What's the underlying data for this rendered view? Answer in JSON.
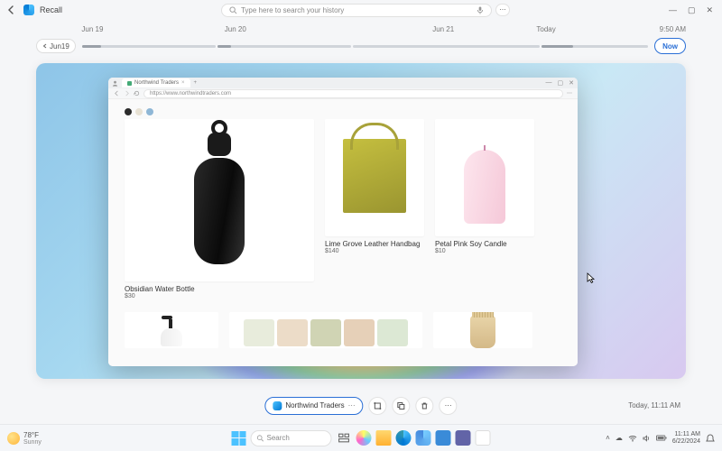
{
  "app": {
    "name": "Recall"
  },
  "search": {
    "placeholder": "Type here to search your history"
  },
  "window_controls": {
    "minimize": "—",
    "maximize": "▢",
    "close": "✕"
  },
  "timeline": {
    "prev_button": "Jun19",
    "now_button": "Now",
    "current_time": "9:50 AM",
    "marks": [
      {
        "label": "Jun 19",
        "pos": 0
      },
      {
        "label": "Jun 20",
        "pos": 25
      },
      {
        "label": "Jun 21",
        "pos": 57
      },
      {
        "label": "Today",
        "pos": 82
      }
    ]
  },
  "snapshot": {
    "browser": {
      "tab_title": "Northwind Traders",
      "url": "https://www.northwindtraders.com",
      "swatches": [
        "#2b2b2b",
        "#e8e2d4",
        "#8fb7d6"
      ],
      "products": [
        {
          "name": "Obsidian  Water Bottle",
          "price": "$30"
        },
        {
          "name": "Lime Grove Leather Handbag",
          "price": "$140"
        },
        {
          "name": "Petal Pink Soy Candle",
          "price": "$10"
        }
      ]
    }
  },
  "actionbar": {
    "app_label": "Northwind Traders",
    "timestamp": "Today, 11:11 AM"
  },
  "taskbar": {
    "weather": {
      "temp": "78°F",
      "cond": "Sunny"
    },
    "search_placeholder": "Search",
    "clock": {
      "time": "11:11 AM",
      "date": "6/22/2024"
    }
  }
}
